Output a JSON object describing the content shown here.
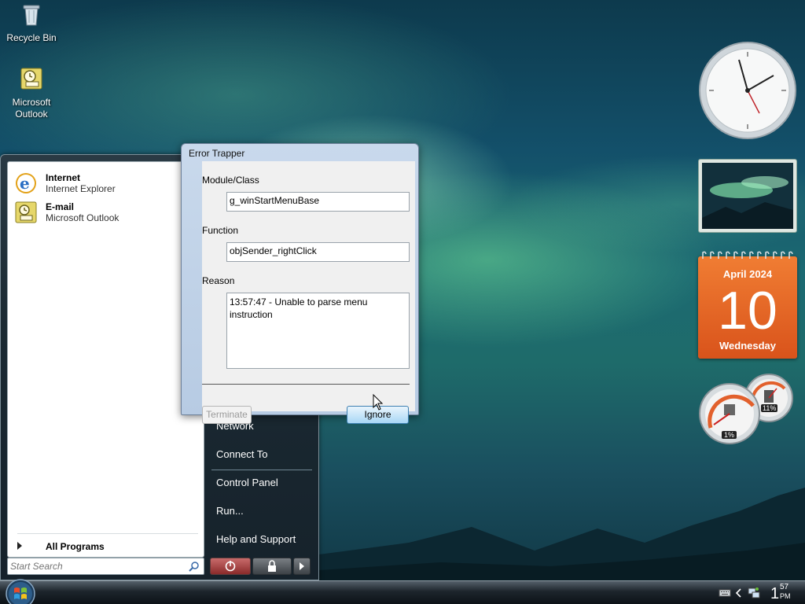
{
  "desktop": {
    "icons": [
      {
        "label": "Recycle Bin",
        "icon": "recycle-bin-icon"
      },
      {
        "label": "Microsoft Outlook",
        "icon": "outlook-icon"
      }
    ]
  },
  "start_menu": {
    "pinned": [
      {
        "title": "Internet",
        "subtitle": "Internet Explorer",
        "icon": "internet-explorer-icon"
      },
      {
        "title": "E-mail",
        "subtitle": "Microsoft Outlook",
        "icon": "outlook-icon"
      }
    ],
    "all_programs_label": "All Programs",
    "search_placeholder": "Start Search",
    "right_items": [
      "Network",
      "Connect To",
      "Control Panel",
      "Run...",
      "Help and Support"
    ]
  },
  "dialog": {
    "title": "Error Trapper",
    "module_label": "Module/Class",
    "module_value": "g_winStartMenuBase",
    "function_label": "Function",
    "function_value": "objSender_rightClick",
    "reason_label": "Reason",
    "reason_value": "13:57:47 - Unable to parse menu instruction",
    "terminate_label": "Terminate",
    "ignore_label": "Ignore"
  },
  "gadgets": {
    "calendar": {
      "month": "April 2024",
      "day": "10",
      "weekday": "Wednesday"
    },
    "cpu_meter": {
      "cpu_percent": "1%",
      "memory_percent": "11%"
    }
  },
  "taskbar": {
    "clock_hour": "1",
    "clock_minute": "57",
    "clock_ampm": "PM"
  },
  "colors": {
    "calendar_orange": "#e8642a",
    "dialog_frame": "#c9d9ec",
    "start_menu_dark": "#1b2a33"
  }
}
